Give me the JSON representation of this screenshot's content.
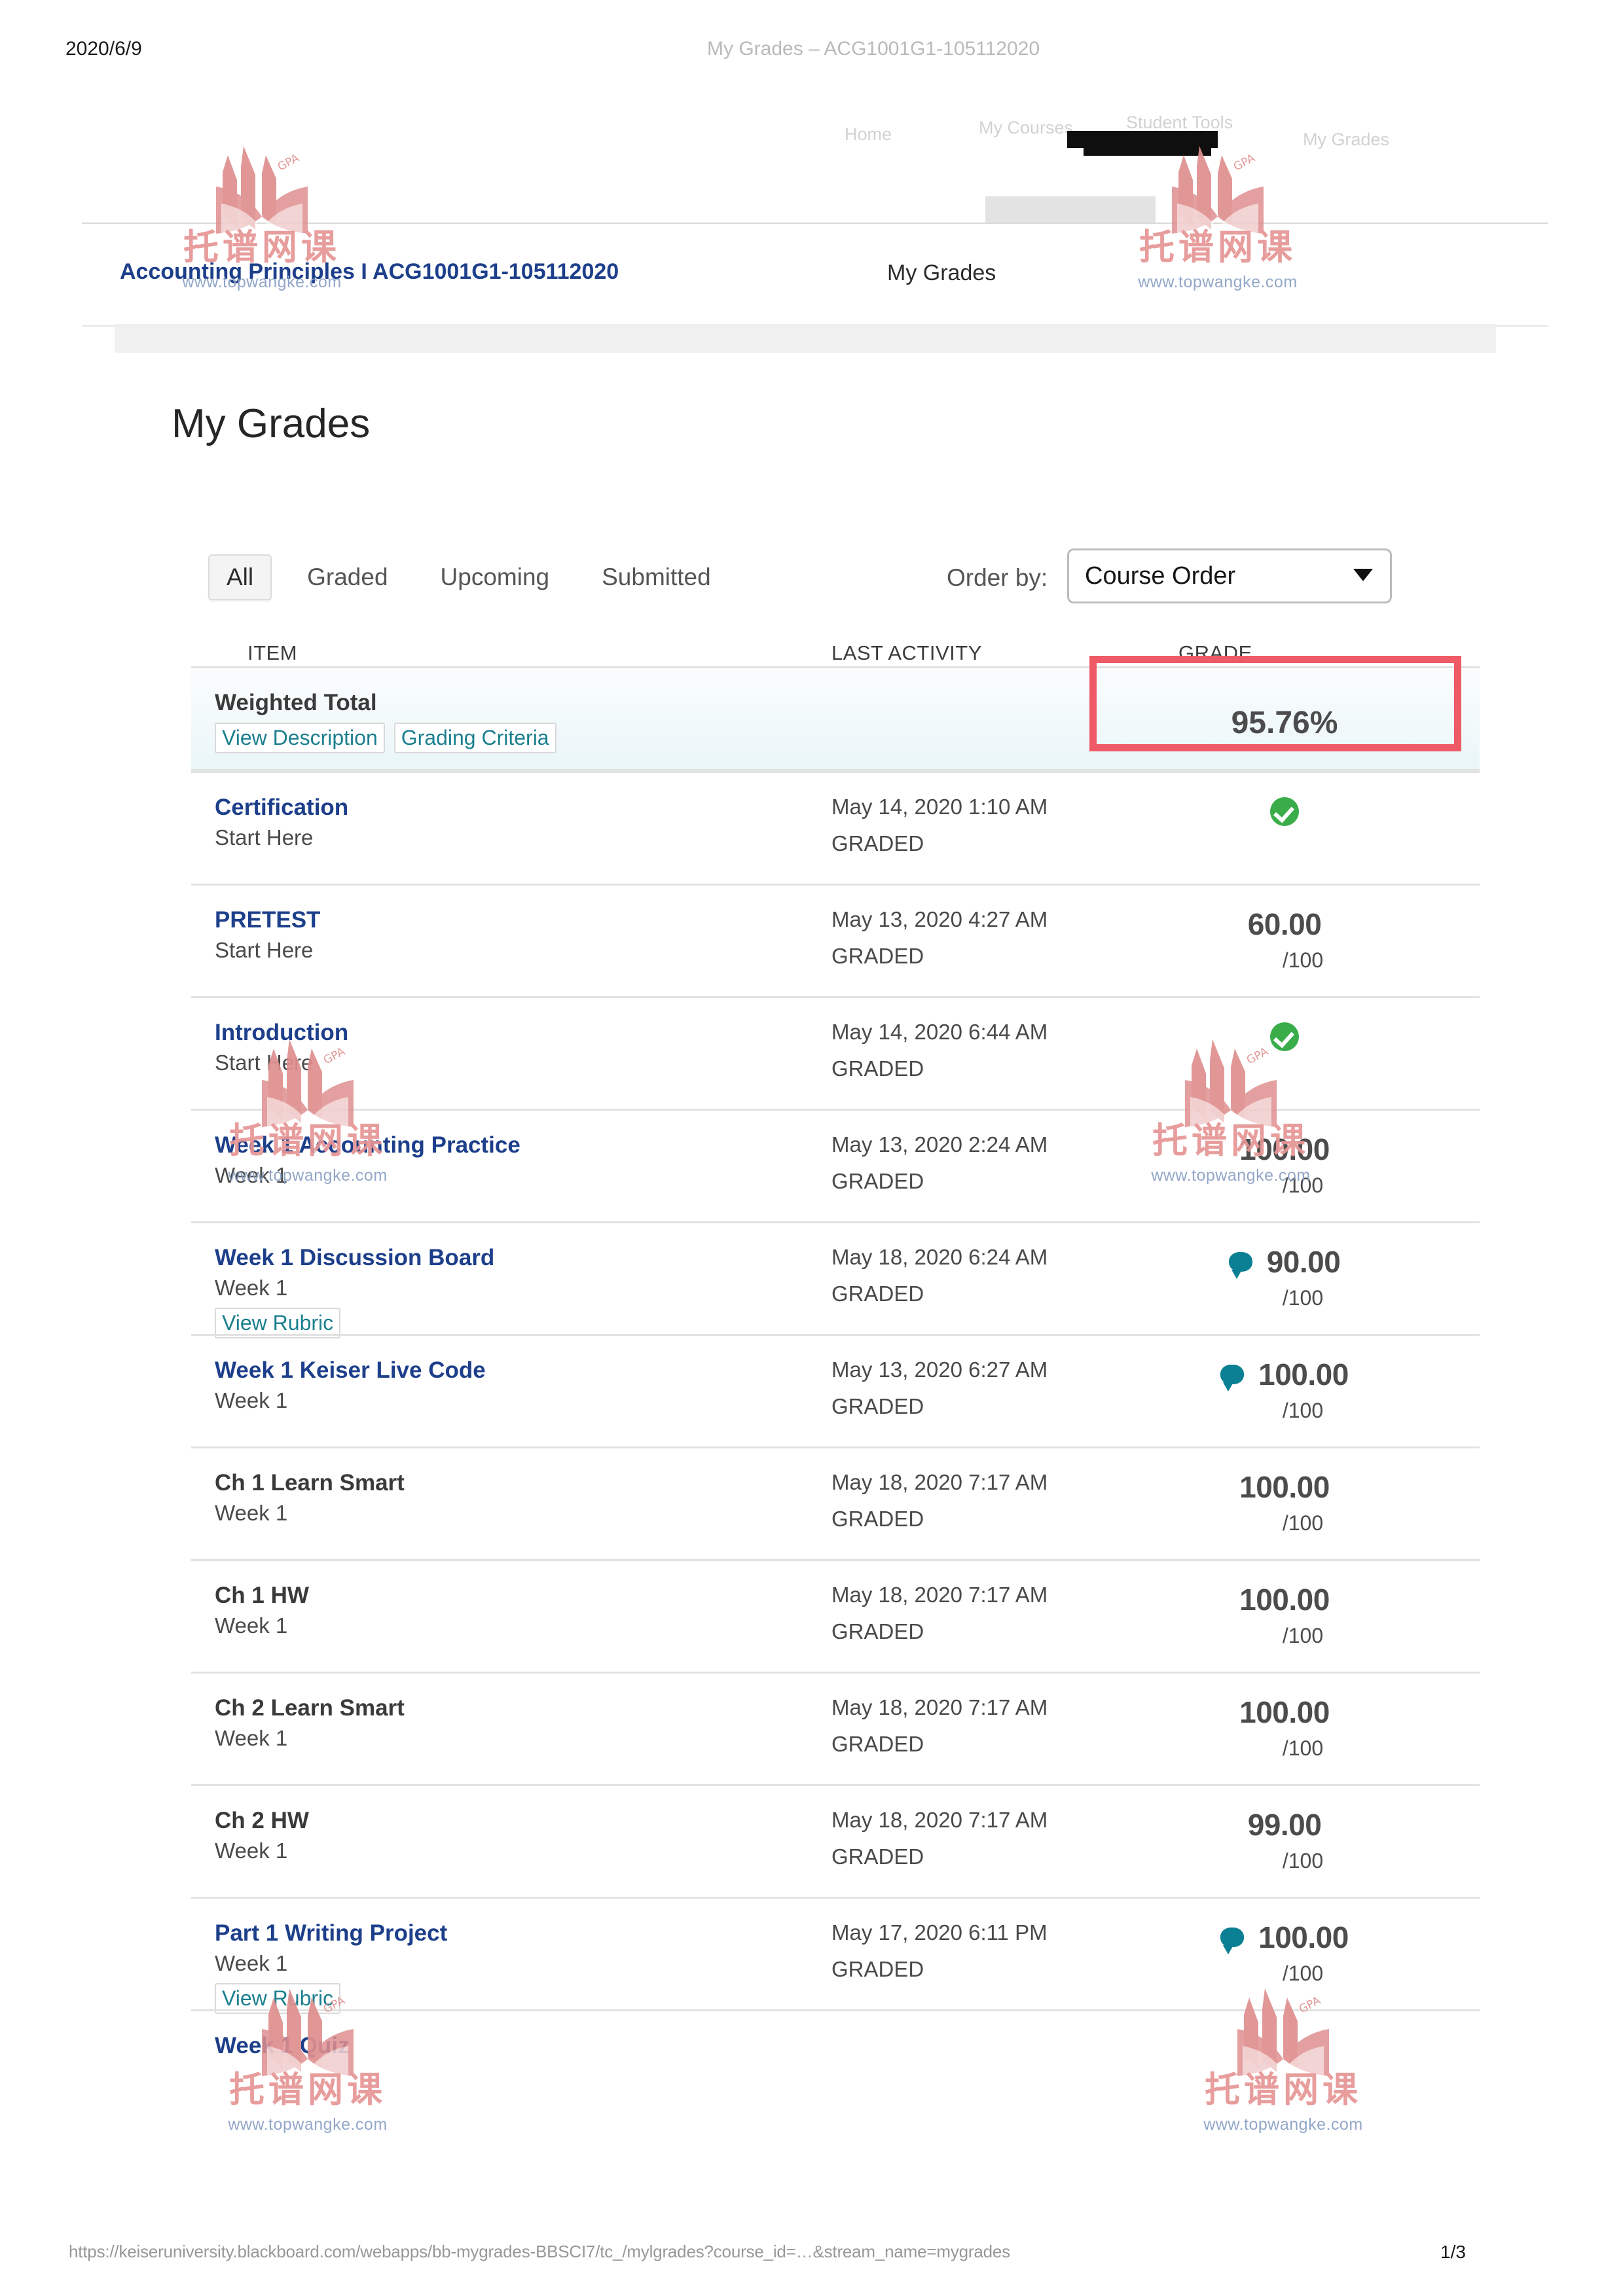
{
  "print_chrome": {
    "date": "2020/6/9",
    "doc_title": "My Grades – ACG1001G1-105112020",
    "url": "https://keiseruniversity.blackboard.com/webapps/bb-mygrades-BBSCI7/tc_/mylgrades?course_id=…&stream_name=mygrades",
    "page_number": "1/3"
  },
  "ghost_nav": {
    "item1": "Home",
    "item2": "My Courses",
    "item3": "Student Tools",
    "item4": "My Grades"
  },
  "breadcrumb": {
    "course": "Accounting Principles I ACG1001G1-105112020",
    "current": "My Grades"
  },
  "page": {
    "title": "My Grades"
  },
  "filters": {
    "tabs": [
      {
        "label": "All",
        "active": true
      },
      {
        "label": "Graded",
        "active": false
      },
      {
        "label": "Upcoming",
        "active": false
      },
      {
        "label": "Submitted",
        "active": false
      }
    ],
    "order_by_label": "Order by:",
    "order_by_value": "Course Order",
    "order_by_caret": "chevron-down-icon"
  },
  "table": {
    "headers": {
      "item": "ITEM",
      "last_activity": "LAST ACTIVITY",
      "grade": "GRADE"
    },
    "rows": [
      {
        "name": "Weighted Total",
        "is_link": false,
        "is_total": true,
        "sub": "",
        "chips": [
          "View Description",
          "Grading Criteria"
        ],
        "activity_date": "",
        "activity_status": "",
        "grade_percent": "95.76%",
        "icon": "none",
        "score": "",
        "denom": ""
      },
      {
        "name": "Certification",
        "is_link": true,
        "sub": "Start Here",
        "chips": [],
        "activity_date": "May 14, 2020 1:10 AM",
        "activity_status": "GRADED",
        "icon": "check",
        "score": "",
        "denom": ""
      },
      {
        "name": "PRETEST",
        "is_link": true,
        "sub": "Start Here",
        "chips": [],
        "activity_date": "May 13, 2020 4:27 AM",
        "activity_status": "GRADED",
        "icon": "none",
        "score": "60.00",
        "denom": "/100"
      },
      {
        "name": "Introduction",
        "is_link": true,
        "sub": "Start Here",
        "chips": [],
        "activity_date": "May 14, 2020 6:44 AM",
        "activity_status": "GRADED",
        "icon": "check",
        "score": "",
        "denom": ""
      },
      {
        "name": "Week 1 Accounting Practice",
        "is_link": true,
        "sub": "Week 1",
        "chips": [],
        "activity_date": "May 13, 2020 2:24 AM",
        "activity_status": "GRADED",
        "icon": "none",
        "score": "100.00",
        "denom": "/100"
      },
      {
        "name": "Week 1 Discussion Board",
        "is_link": true,
        "sub": "Week 1",
        "chips": [
          "View Rubric"
        ],
        "activity_date": "May 18, 2020 6:24 AM",
        "activity_status": "GRADED",
        "icon": "comment",
        "score": "90.00",
        "denom": "/100"
      },
      {
        "name": "Week 1 Keiser Live Code",
        "is_link": true,
        "sub": "Week 1",
        "chips": [],
        "activity_date": "May 13, 2020 6:27 AM",
        "activity_status": "GRADED",
        "icon": "comment",
        "score": "100.00",
        "denom": "/100"
      },
      {
        "name": "Ch 1 Learn Smart",
        "is_link": false,
        "sub": "Week 1",
        "chips": [],
        "activity_date": "May 18, 2020 7:17 AM",
        "activity_status": "GRADED",
        "icon": "none",
        "score": "100.00",
        "denom": "/100"
      },
      {
        "name": "Ch 1 HW",
        "is_link": false,
        "sub": "Week 1",
        "chips": [],
        "activity_date": "May 18, 2020 7:17 AM",
        "activity_status": "GRADED",
        "icon": "none",
        "score": "100.00",
        "denom": "/100"
      },
      {
        "name": "Ch 2 Learn Smart",
        "is_link": false,
        "sub": "Week 1",
        "chips": [],
        "activity_date": "May 18, 2020 7:17 AM",
        "activity_status": "GRADED",
        "icon": "none",
        "score": "100.00",
        "denom": "/100"
      },
      {
        "name": "Ch 2 HW",
        "is_link": false,
        "sub": "Week 1",
        "chips": [],
        "activity_date": "May 18, 2020 7:17 AM",
        "activity_status": "GRADED",
        "icon": "none",
        "score": "99.00",
        "denom": "/100"
      },
      {
        "name": "Part 1 Writing Project",
        "is_link": true,
        "sub": "Week 1",
        "chips": [
          "View Rubric"
        ],
        "activity_date": "May 17, 2020 6:11 PM",
        "activity_status": "GRADED",
        "icon": "comment",
        "score": "100.00",
        "denom": "/100"
      },
      {
        "name": "Week 1 Quiz",
        "is_link": true,
        "sub": "",
        "chips": [],
        "activity_date": "",
        "activity_status": "",
        "icon": "none",
        "score": "",
        "denom": ""
      }
    ]
  },
  "watermark": {
    "cn_text": "托谱网课",
    "url_text": "www.topwangke.com"
  },
  "colors": {
    "link_blue": "#1d3f8b",
    "chip_teal": "#1a7f8e",
    "annotation_red": "#ee5a66",
    "status_green": "#3aad4a",
    "comment_teal": "#0b7f93",
    "total_bg": "#eaf6f8"
  }
}
